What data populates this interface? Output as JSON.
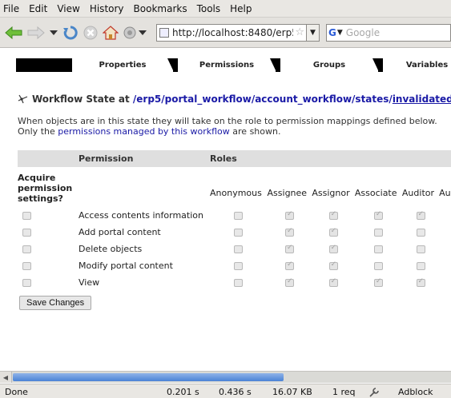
{
  "menubar": {
    "items": [
      "File",
      "Edit",
      "View",
      "History",
      "Bookmarks",
      "Tools",
      "Help"
    ]
  },
  "navbar": {
    "url": "http://localhost:8480/erp5",
    "search_placeholder": "Google"
  },
  "tabs": [
    "Properties",
    "Permissions",
    "Groups",
    "Variables"
  ],
  "active_tab": "Permissions",
  "state": {
    "prefix": "Workflow State at",
    "path_link": "/erp5/portal_workflow/account_workflow/states/",
    "state_link": "invalidated"
  },
  "description": {
    "line1": "When objects are in this state they will take on the role to permission mappings defined below.",
    "line2_prefix": "Only the",
    "line2_link": "permissions managed by this workflow",
    "line2_suffix": "are shown."
  },
  "table": {
    "header_permission": "Permission",
    "header_roles": "Roles",
    "acquire_label": "Acquire permission settings?",
    "roles": [
      "Anonymous",
      "Assignee",
      "Assignor",
      "Associate",
      "Auditor",
      "Au"
    ],
    "rows": [
      {
        "name": "Access contents information",
        "acquire": false,
        "checks": [
          false,
          true,
          true,
          true,
          true
        ]
      },
      {
        "name": "Add portal content",
        "acquire": false,
        "checks": [
          false,
          true,
          true,
          false,
          false
        ]
      },
      {
        "name": "Delete objects",
        "acquire": false,
        "checks": [
          false,
          true,
          true,
          false,
          false
        ]
      },
      {
        "name": "Modify portal content",
        "acquire": false,
        "checks": [
          false,
          true,
          true,
          false,
          false
        ]
      },
      {
        "name": "View",
        "acquire": false,
        "checks": [
          false,
          true,
          true,
          true,
          true
        ]
      }
    ]
  },
  "save_label": "Save Changes",
  "statusbar": {
    "state": "Done",
    "t1": "0.201 s",
    "t2": "0.436 s",
    "size": "16.07 KB",
    "req": "1 req",
    "adblock": "Adblock"
  }
}
